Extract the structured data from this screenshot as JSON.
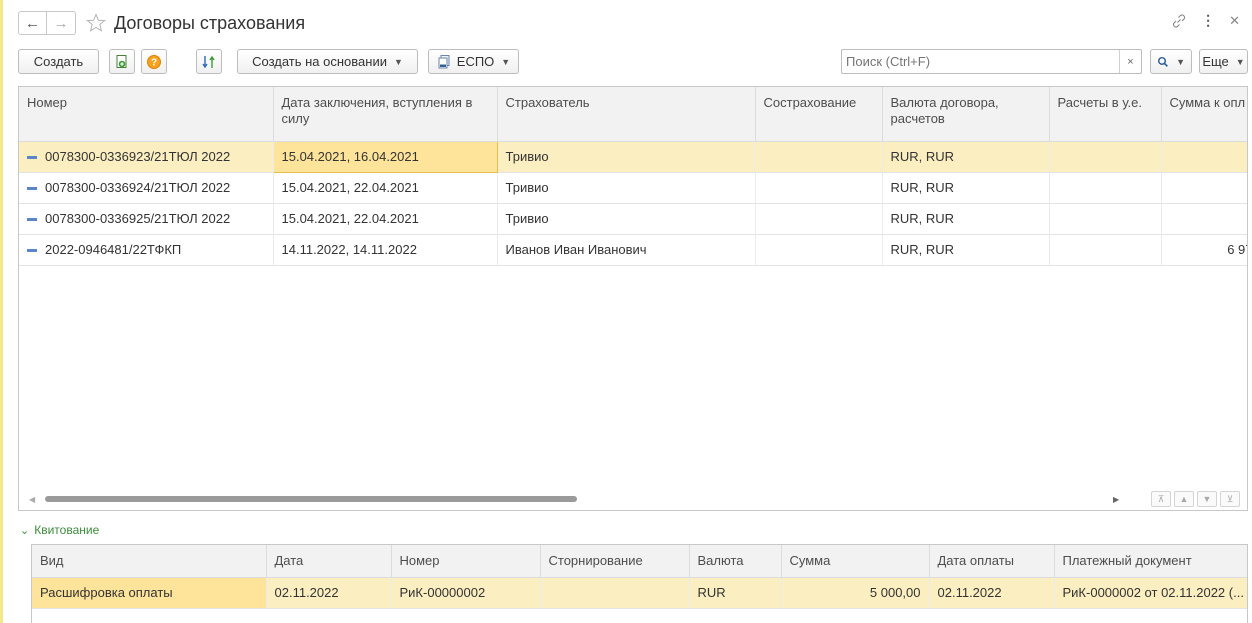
{
  "window": {
    "title": "Договоры страхования",
    "back_icon": "arrow-left-icon",
    "forward_icon": "arrow-right-icon",
    "favorite_icon": "star-icon",
    "link_icon": "link-icon",
    "more_icon": "kebab-menu-icon",
    "close_icon": "close-icon"
  },
  "toolbar": {
    "create_label": "Создать",
    "create_on_basis_label": "Создать на основании",
    "espo_label": "ЕСПО",
    "search_placeholder": "Поиск (Ctrl+F)",
    "clear_label": "×",
    "more_label": "Еще"
  },
  "contracts": {
    "columns": [
      "Номер",
      "Дата заключения, вступления в силу",
      "Страхователь",
      "Сострахование",
      "Валюта договора, расчетов",
      "Расчеты в у.е.",
      "Сумма к опл"
    ],
    "rows": [
      {
        "number": "0078300-0336923/21ТЮЛ 2022",
        "dates": "15.04.2021, 16.04.2021",
        "insurer": "Тривио",
        "coinsurance": "",
        "currency": "RUR, RUR",
        "conventional_units": "",
        "amount": ""
      },
      {
        "number": "0078300-0336924/21ТЮЛ 2022",
        "dates": "15.04.2021, 22.04.2021",
        "insurer": "Тривио",
        "coinsurance": "",
        "currency": "RUR, RUR",
        "conventional_units": "",
        "amount": ""
      },
      {
        "number": "0078300-0336925/21ТЮЛ 2022",
        "dates": "15.04.2021, 22.04.2021",
        "insurer": "Тривио",
        "coinsurance": "",
        "currency": "RUR, RUR",
        "conventional_units": "",
        "amount": ""
      },
      {
        "number": "2022-0946481/22ТФКП",
        "dates": "14.11.2022, 14.11.2022",
        "insurer": "Иванов Иван Иванович",
        "coinsurance": "",
        "currency": "RUR, RUR",
        "conventional_units": "",
        "amount": "6 97"
      }
    ],
    "scroll_position": 0.49
  },
  "reconciliation": {
    "section_label": "Квитование",
    "columns": [
      "Вид",
      "Дата",
      "Номер",
      "Сторнирование",
      "Валюта",
      "Сумма",
      "Дата оплаты",
      "Платежный документ"
    ],
    "rows": [
      {
        "kind": "Расшифровка оплаты",
        "date": "02.11.2022",
        "number": "РиК-00000002",
        "reversal": "",
        "currency": "RUR",
        "sum": "5 000,00",
        "payment_date": "02.11.2022",
        "payment_document": "РиК-0000002 от 02.11.2022 (..."
      }
    ]
  }
}
